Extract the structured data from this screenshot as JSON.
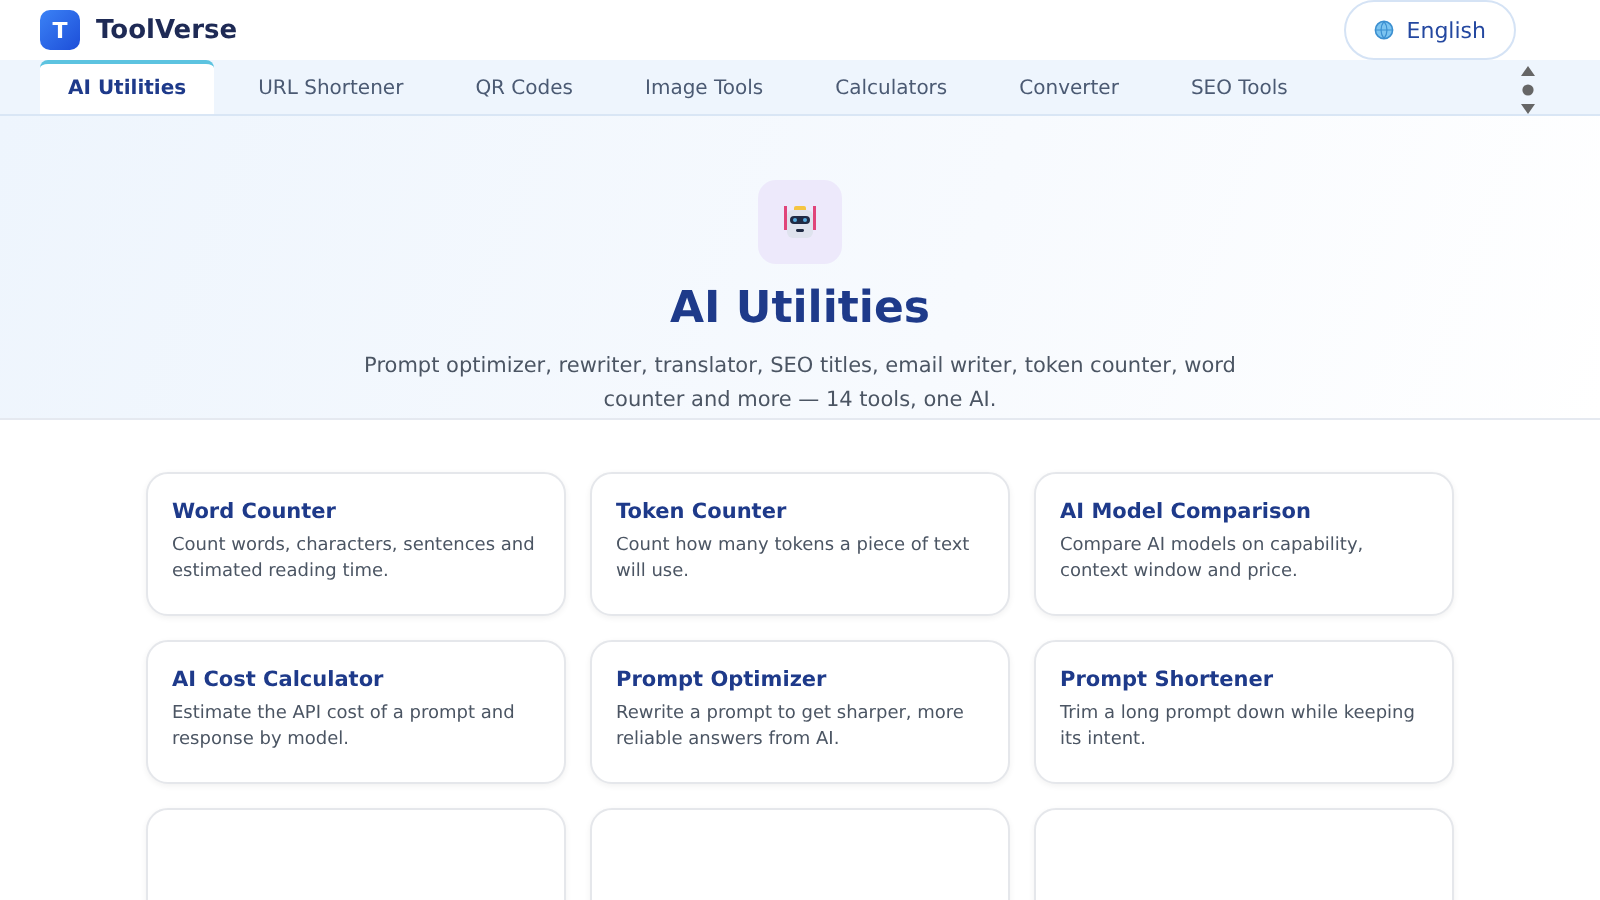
{
  "brand": {
    "logo_letter": "T",
    "name": "ToolVerse"
  },
  "language_button": {
    "label": "English"
  },
  "tabs": [
    {
      "label": "AI Utilities",
      "selected": true
    },
    {
      "label": "URL Shortener",
      "selected": false
    },
    {
      "label": "QR Codes",
      "selected": false
    },
    {
      "label": "Image Tools",
      "selected": false
    },
    {
      "label": "Calculators",
      "selected": false
    },
    {
      "label": "Converter",
      "selected": false
    },
    {
      "label": "SEO Tools",
      "selected": false
    }
  ],
  "hero": {
    "title": "AI Utilities",
    "description": "Prompt optimizer, rewriter, translator, SEO titles, email writer, token counter, word counter and more — 14 tools, one AI."
  },
  "tools": [
    {
      "title": "Word Counter",
      "description": "Count words, characters, sentences and estimated reading time."
    },
    {
      "title": "Token Counter",
      "description": "Count how many tokens a piece of text will use."
    },
    {
      "title": "AI Model Comparison",
      "description": "Compare AI models on capability, context window and price."
    },
    {
      "title": "AI Cost Calculator",
      "description": "Estimate the API cost of a prompt and response by model."
    },
    {
      "title": "Prompt Optimizer",
      "description": "Rewrite a prompt to get sharper, more reliable answers from AI."
    },
    {
      "title": "Prompt Shortener",
      "description": "Trim a long prompt down while keeping its intent."
    }
  ]
}
